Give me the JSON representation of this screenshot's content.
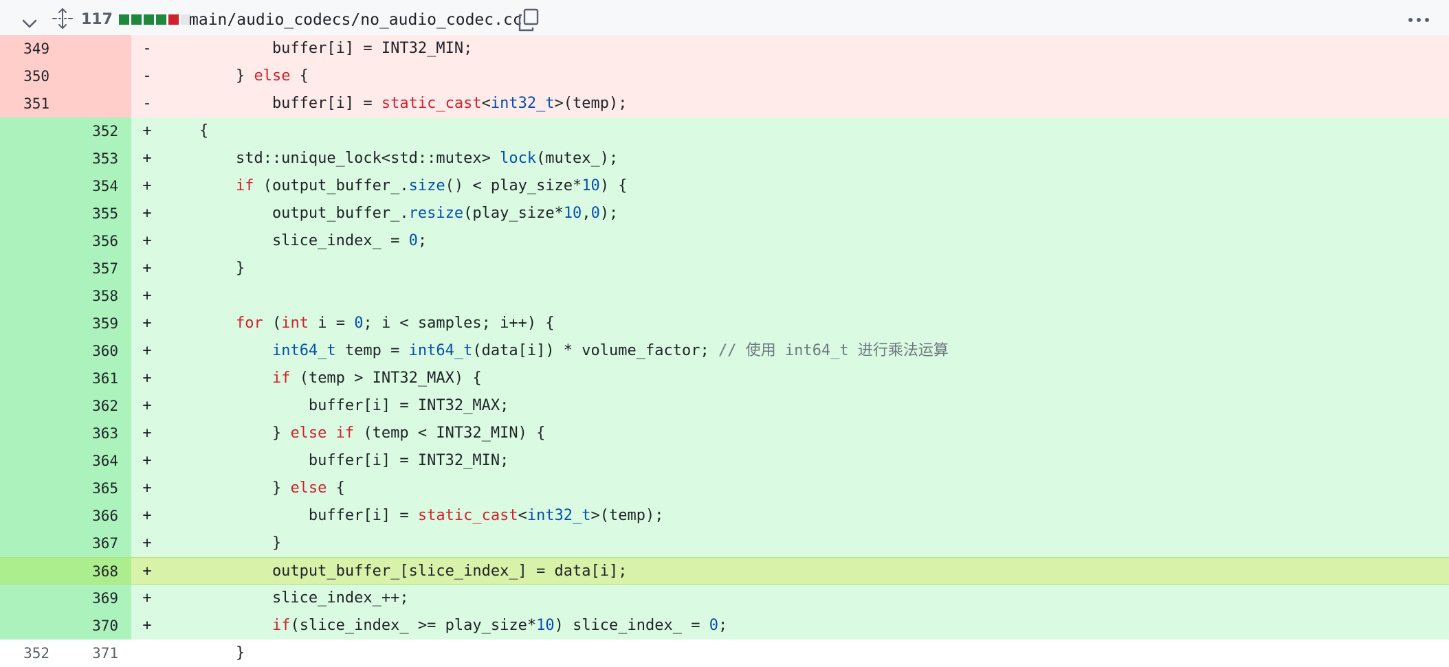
{
  "header": {
    "change_count": "117",
    "filename": "main/audio_codecs/no_audio_codec.cc",
    "diffstat": [
      "add",
      "add",
      "add",
      "add",
      "del",
      "neutral"
    ],
    "icons": [
      "chevron-down-icon",
      "expand-icon",
      "copy-icon",
      "kebab-menu-icon"
    ]
  },
  "colors": {
    "added_bg": "#dafbe1",
    "added_gutter": "#acf2bd",
    "deleted_bg": "#ffebe9",
    "deleted_gutter": "#ffcecb",
    "highlight_bg": "#d9f2a9",
    "keyword": "#cf222e",
    "type": "#0550ae"
  },
  "rows": [
    {
      "type": "del",
      "old": "349",
      "new": "",
      "sign": "-",
      "code": [
        {
          "t": "            buffer[i] = INT32_MIN;"
        }
      ]
    },
    {
      "type": "del",
      "old": "350",
      "new": "",
      "sign": "-",
      "code": [
        {
          "t": "        } "
        },
        {
          "t": "else",
          "c": "kw"
        },
        {
          "t": " {"
        }
      ]
    },
    {
      "type": "del",
      "old": "351",
      "new": "",
      "sign": "-",
      "code": [
        {
          "t": "            buffer[i] = "
        },
        {
          "t": "static_cast",
          "c": "kw"
        },
        {
          "t": "<"
        },
        {
          "t": "int32_t",
          "c": "ty"
        },
        {
          "t": ">(temp);"
        }
      ]
    },
    {
      "type": "add",
      "old": "",
      "new": "352",
      "sign": "+",
      "code": [
        {
          "t": "    {"
        }
      ]
    },
    {
      "type": "add",
      "old": "",
      "new": "353",
      "sign": "+",
      "code": [
        {
          "t": "        std::unique_lock<std::mutex> "
        },
        {
          "t": "lock",
          "c": "fn"
        },
        {
          "t": "(mutex_);"
        }
      ]
    },
    {
      "type": "add",
      "old": "",
      "new": "354",
      "sign": "+",
      "code": [
        {
          "t": "        "
        },
        {
          "t": "if",
          "c": "kw"
        },
        {
          "t": " (output_buffer_."
        },
        {
          "t": "size",
          "c": "fn"
        },
        {
          "t": "() < play_size*"
        },
        {
          "t": "10",
          "c": "nm"
        },
        {
          "t": ") {"
        }
      ]
    },
    {
      "type": "add",
      "old": "",
      "new": "355",
      "sign": "+",
      "code": [
        {
          "t": "            output_buffer_."
        },
        {
          "t": "resize",
          "c": "fn"
        },
        {
          "t": "(play_size*"
        },
        {
          "t": "10",
          "c": "nm"
        },
        {
          "t": ","
        },
        {
          "t": "0",
          "c": "nm"
        },
        {
          "t": ");"
        }
      ]
    },
    {
      "type": "add",
      "old": "",
      "new": "356",
      "sign": "+",
      "code": [
        {
          "t": "            slice_index_ = "
        },
        {
          "t": "0",
          "c": "nm"
        },
        {
          "t": ";"
        }
      ]
    },
    {
      "type": "add",
      "old": "",
      "new": "357",
      "sign": "+",
      "code": [
        {
          "t": "        }"
        }
      ]
    },
    {
      "type": "add",
      "old": "",
      "new": "358",
      "sign": "+",
      "code": [
        {
          "t": ""
        }
      ]
    },
    {
      "type": "add",
      "old": "",
      "new": "359",
      "sign": "+",
      "code": [
        {
          "t": "        "
        },
        {
          "t": "for",
          "c": "kw"
        },
        {
          "t": " ("
        },
        {
          "t": "int",
          "c": "kw"
        },
        {
          "t": " i = "
        },
        {
          "t": "0",
          "c": "nm"
        },
        {
          "t": "; i < samples; i++) {"
        }
      ]
    },
    {
      "type": "add",
      "old": "",
      "new": "360",
      "sign": "+",
      "code": [
        {
          "t": "            "
        },
        {
          "t": "int64_t",
          "c": "ty"
        },
        {
          "t": " temp = "
        },
        {
          "t": "int64_t",
          "c": "ty"
        },
        {
          "t": "(data[i]) * volume_factor; "
        },
        {
          "t": "// 使用 int64_t 进行乘法运算",
          "c": "cm"
        }
      ]
    },
    {
      "type": "add",
      "old": "",
      "new": "361",
      "sign": "+",
      "code": [
        {
          "t": "            "
        },
        {
          "t": "if",
          "c": "kw"
        },
        {
          "t": " (temp > INT32_MAX) {"
        }
      ]
    },
    {
      "type": "add",
      "old": "",
      "new": "362",
      "sign": "+",
      "code": [
        {
          "t": "                buffer[i] = INT32_MAX;"
        }
      ]
    },
    {
      "type": "add",
      "old": "",
      "new": "363",
      "sign": "+",
      "code": [
        {
          "t": "            } "
        },
        {
          "t": "else",
          "c": "kw"
        },
        {
          "t": " "
        },
        {
          "t": "if",
          "c": "kw"
        },
        {
          "t": " (temp < INT32_MIN) {"
        }
      ]
    },
    {
      "type": "add",
      "old": "",
      "new": "364",
      "sign": "+",
      "code": [
        {
          "t": "                buffer[i] = INT32_MIN;"
        }
      ]
    },
    {
      "type": "add",
      "old": "",
      "new": "365",
      "sign": "+",
      "code": [
        {
          "t": "            } "
        },
        {
          "t": "else",
          "c": "kw"
        },
        {
          "t": " {"
        }
      ]
    },
    {
      "type": "add",
      "old": "",
      "new": "366",
      "sign": "+",
      "code": [
        {
          "t": "                buffer[i] = "
        },
        {
          "t": "static_cast",
          "c": "kw"
        },
        {
          "t": "<"
        },
        {
          "t": "int32_t",
          "c": "ty"
        },
        {
          "t": ">(temp);"
        }
      ]
    },
    {
      "type": "add",
      "old": "",
      "new": "367",
      "sign": "+",
      "code": [
        {
          "t": "            }"
        }
      ]
    },
    {
      "type": "hl",
      "old": "",
      "new": "368",
      "sign": "+",
      "code": [
        {
          "t": "            output_buffer_[slice_index_] = data[i];"
        }
      ]
    },
    {
      "type": "add",
      "old": "",
      "new": "369",
      "sign": "+",
      "code": [
        {
          "t": "            slice_index_++;"
        }
      ]
    },
    {
      "type": "add",
      "old": "",
      "new": "370",
      "sign": "+",
      "code": [
        {
          "t": "            "
        },
        {
          "t": "if",
          "c": "kw"
        },
        {
          "t": "(slice_index_ >= play_size*"
        },
        {
          "t": "10",
          "c": "nm"
        },
        {
          "t": ") slice_index_ = "
        },
        {
          "t": "0",
          "c": "nm"
        },
        {
          "t": ";"
        }
      ]
    },
    {
      "type": "ctx",
      "old": "352",
      "new": "371",
      "sign": "",
      "code": [
        {
          "t": "        }"
        }
      ]
    }
  ]
}
